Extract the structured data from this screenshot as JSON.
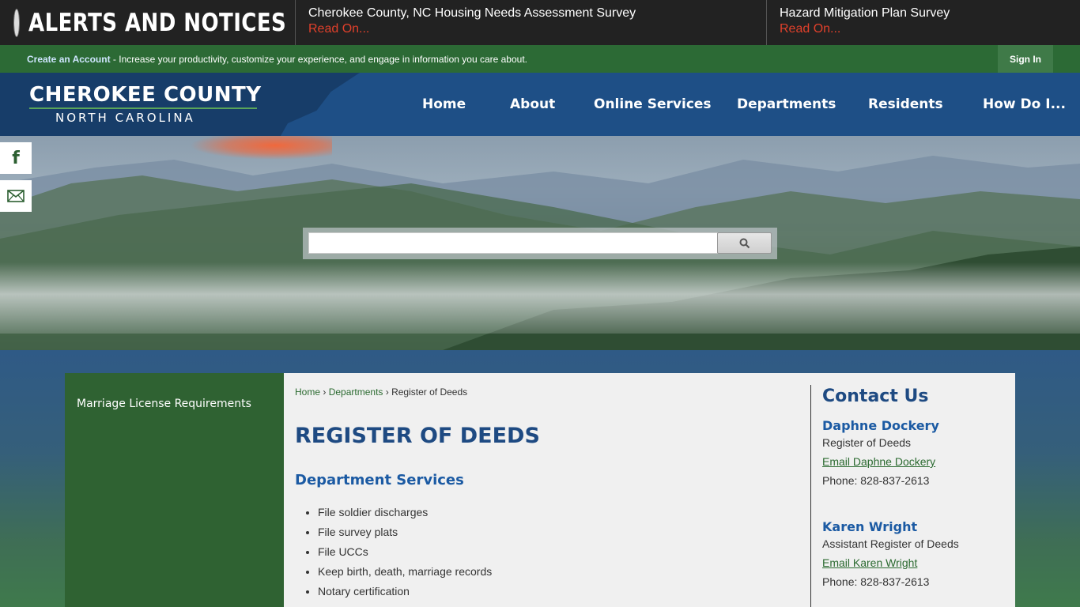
{
  "alerts": {
    "title": "ALERTS AND NOTICES",
    "items": [
      {
        "title": "Cherokee County, NC Housing Needs Assessment Survey",
        "link": "Read On..."
      },
      {
        "title": "Hazard Mitigation Plan Survey",
        "link": "Read On..."
      }
    ]
  },
  "account_bar": {
    "create_link": "Create an Account",
    "message": " - Increase your productivity, customize your experience, and engage in information you care about.",
    "sign_in": "Sign In"
  },
  "logo": {
    "line1": "CHEROKEE COUNTY",
    "line2": "NORTH CAROLINA"
  },
  "nav": [
    "Home",
    "About",
    "Online Services",
    "Departments",
    "Residents",
    "How Do I..."
  ],
  "search": {
    "button_icon": "search-icon"
  },
  "social": [
    "facebook-icon",
    "email-icon"
  ],
  "sidebar": {
    "items": [
      "Marriage License Requirements"
    ]
  },
  "breadcrumb": {
    "home": "Home",
    "departments": "Departments",
    "current": "Register of Deeds",
    "sep": "›"
  },
  "page": {
    "title": "REGISTER OF DEEDS",
    "subtitle": "Department Services",
    "services": [
      "File soldier discharges",
      "File survey plats",
      "File UCCs",
      "Keep birth, death, marriage records",
      "Notary certification"
    ]
  },
  "contact": {
    "title": "Contact Us",
    "people": [
      {
        "name": "Daphne Dockery",
        "role": "Register of Deeds",
        "email": "Email Daphne Dockery",
        "phone": "Phone: 828-837-2613"
      },
      {
        "name": "Karen Wright",
        "role": "Assistant Register of Deeds",
        "email": "Email Karen Wright",
        "phone": "Phone: 828-837-2613"
      }
    ]
  },
  "colors": {
    "alert_bg": "#222222",
    "account_bar": "#2c6a35",
    "header": "#1e4f86",
    "accent_red": "#e0402b",
    "title_blue": "#1e4a82"
  }
}
